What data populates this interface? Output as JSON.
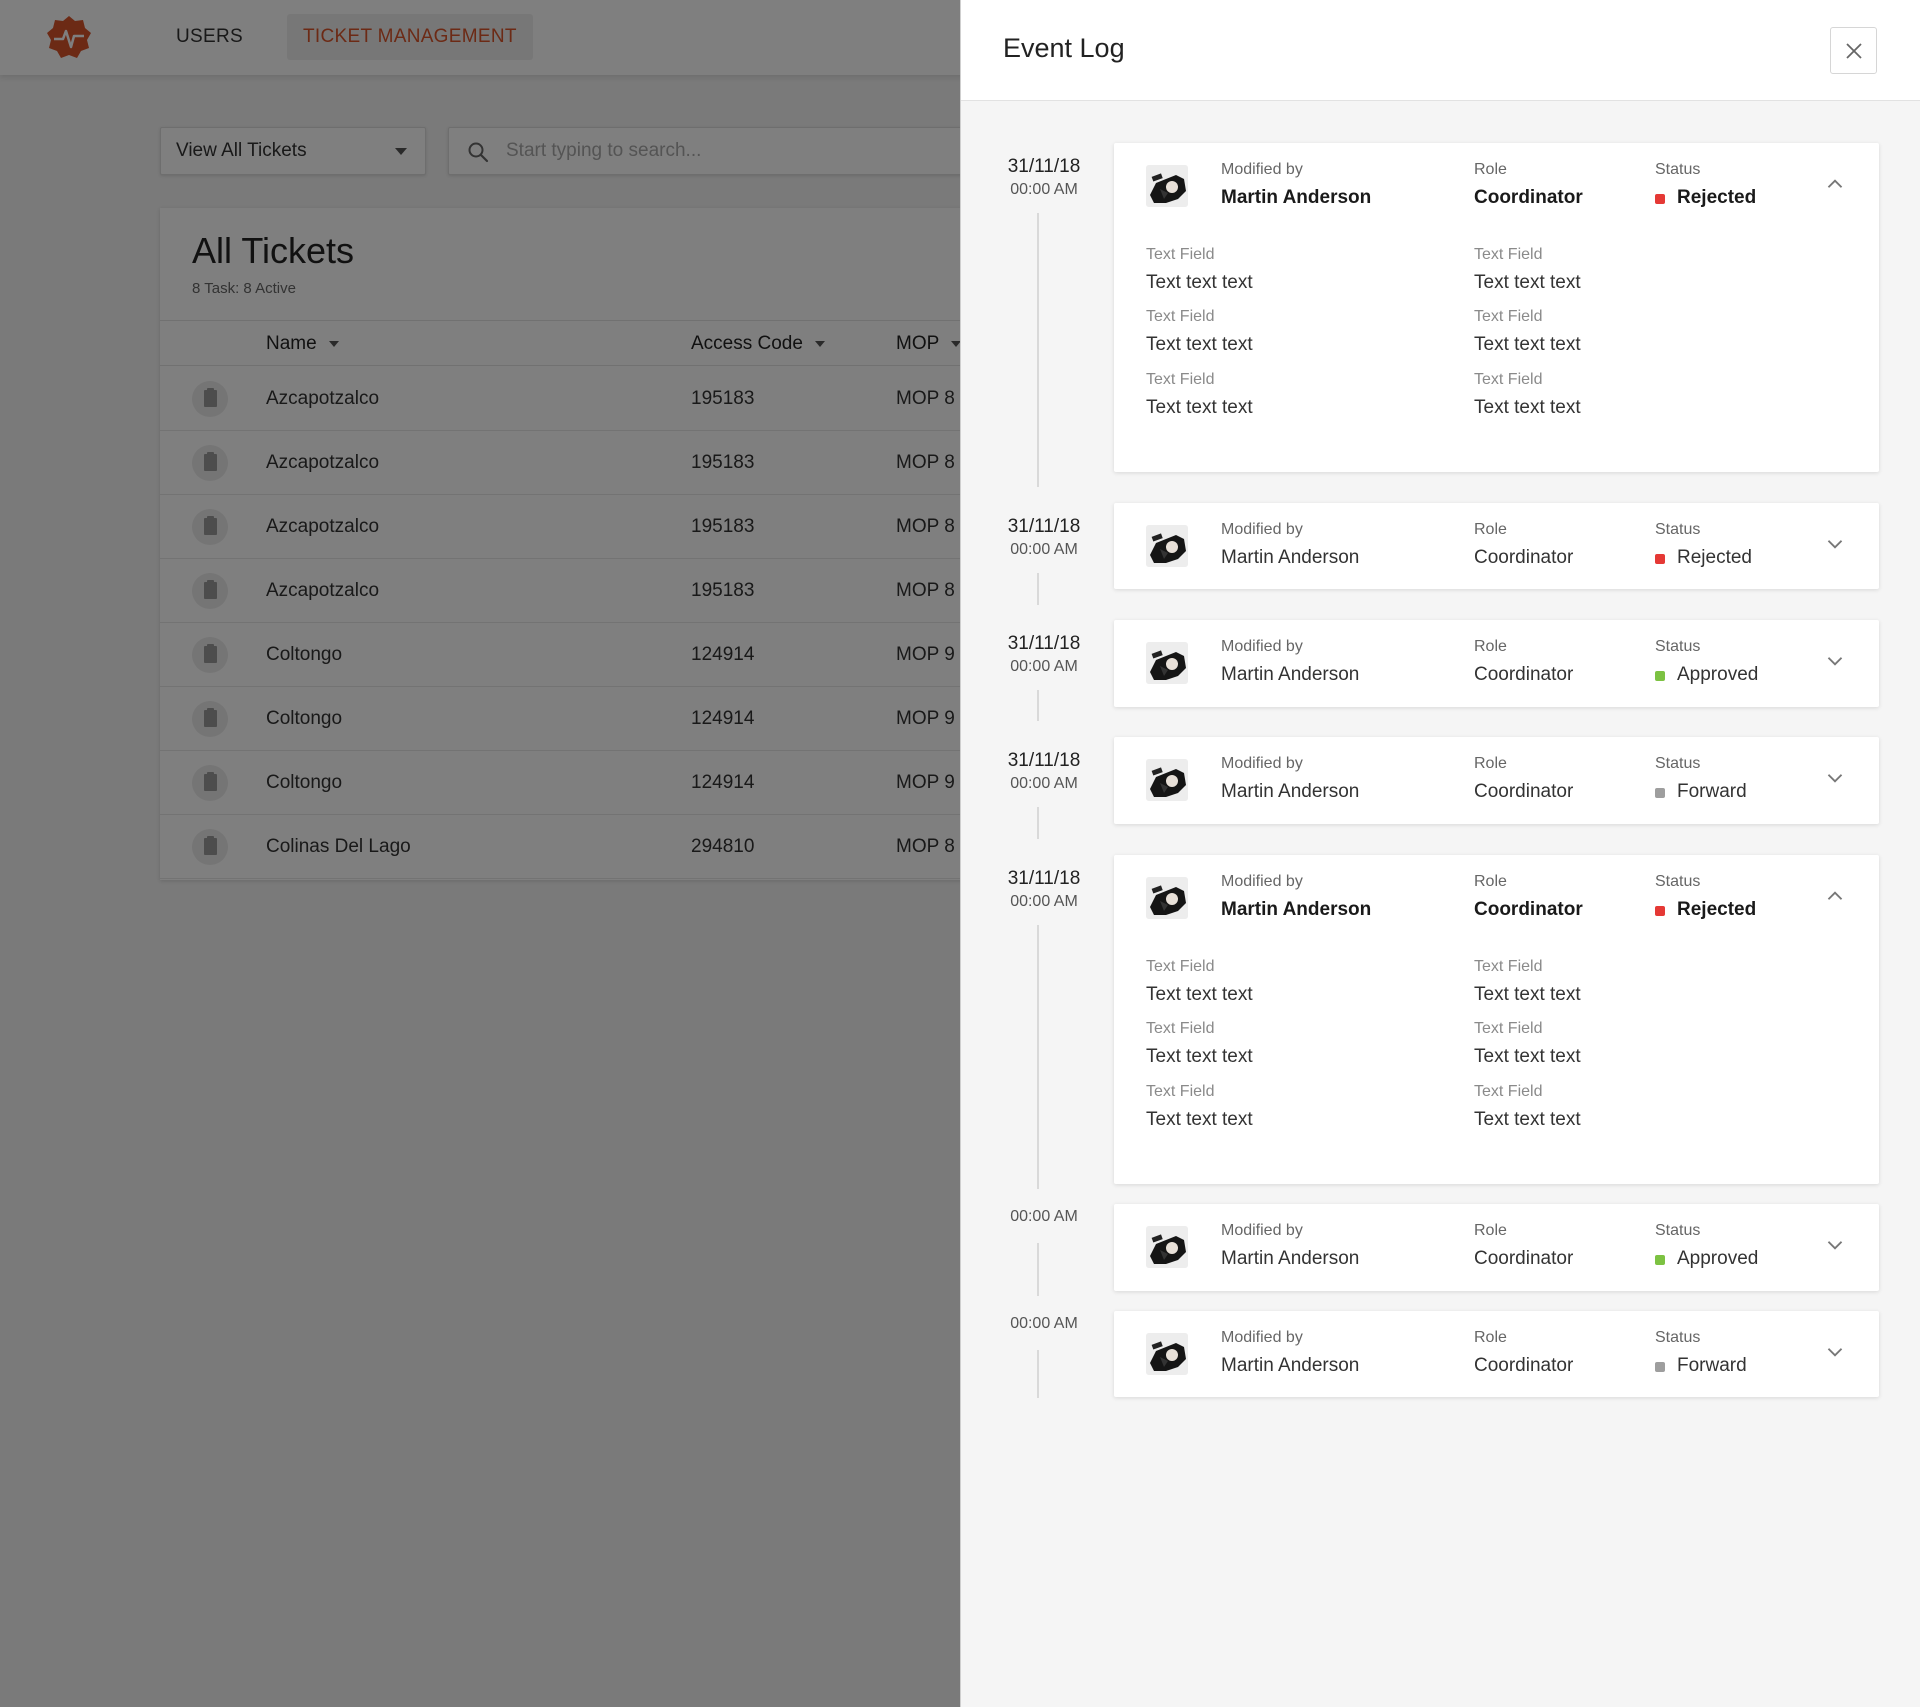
{
  "nav": {
    "items": [
      {
        "label": "USERS"
      },
      {
        "label": "TICKET MANAGEMENT"
      }
    ]
  },
  "toolbar": {
    "view_select": "View All Tickets",
    "search_placeholder": "Start typing to search..."
  },
  "tickets": {
    "title": "All Tickets",
    "subtitle": "8 Task: 8 Active",
    "columns": [
      "Name",
      "Access Code",
      "MOP"
    ],
    "rows": [
      {
        "name": "Azcapotzalco",
        "code": "195183",
        "mop": "MOP 8"
      },
      {
        "name": "Azcapotzalco",
        "code": "195183",
        "mop": "MOP 8"
      },
      {
        "name": "Azcapotzalco",
        "code": "195183",
        "mop": "MOP 8"
      },
      {
        "name": "Azcapotzalco",
        "code": "195183",
        "mop": "MOP 8"
      },
      {
        "name": "Coltongo",
        "code": "124914",
        "mop": "MOP 9"
      },
      {
        "name": "Coltongo",
        "code": "124914",
        "mop": "MOP 9"
      },
      {
        "name": "Coltongo",
        "code": "124914",
        "mop": "MOP 9"
      },
      {
        "name": "Colinas Del Lago",
        "code": "294810",
        "mop": "MOP 8"
      }
    ]
  },
  "event_log": {
    "title": "Event Log",
    "labels": {
      "modified_by": "Modified by",
      "role": "Role",
      "status": "Status"
    },
    "status_colors": {
      "Rejected": "#e53935",
      "Approved": "#7cc242",
      "Forward": "#9e9e9e"
    },
    "events": [
      {
        "date": "31/11/18",
        "time": "00:00 AM",
        "modified_by": "Martin Anderson",
        "role": "Coordinator",
        "status": "Rejected",
        "expanded": true,
        "fields": [
          {
            "label": "Text Field",
            "value": "Text text text"
          },
          {
            "label": "Text Field",
            "value": "Text text text"
          },
          {
            "label": "Text Field",
            "value": "Text text text"
          },
          {
            "label": "Text Field",
            "value": "Text text text"
          },
          {
            "label": "Text Field",
            "value": "Text text text"
          },
          {
            "label": "Text Field",
            "value": "Text text text"
          }
        ]
      },
      {
        "date": "31/11/18",
        "time": "00:00 AM",
        "modified_by": "Martin Anderson",
        "role": "Coordinator",
        "status": "Rejected",
        "expanded": false
      },
      {
        "date": "31/11/18",
        "time": "00:00 AM",
        "modified_by": "Martin Anderson",
        "role": "Coordinator",
        "status": "Approved",
        "expanded": false
      },
      {
        "date": "31/11/18",
        "time": "00:00 AM",
        "modified_by": "Martin Anderson",
        "role": "Coordinator",
        "status": "Forward",
        "expanded": false
      },
      {
        "date": "31/11/18",
        "time": "00:00 AM",
        "modified_by": "Martin Anderson",
        "role": "Coordinator",
        "status": "Rejected",
        "expanded": true,
        "fields": [
          {
            "label": "Text Field",
            "value": "Text text text"
          },
          {
            "label": "Text Field",
            "value": "Text text text"
          },
          {
            "label": "Text Field",
            "value": "Text text text"
          },
          {
            "label": "Text Field",
            "value": "Text text text"
          },
          {
            "label": "Text Field",
            "value": "Text text text"
          },
          {
            "label": "Text Field",
            "value": "Text text text"
          }
        ]
      },
      {
        "date": "",
        "time": "00:00 AM",
        "modified_by": "Martin Anderson",
        "role": "Coordinator",
        "status": "Approved",
        "expanded": false
      },
      {
        "date": "",
        "time": "00:00 AM",
        "modified_by": "Martin Anderson",
        "role": "Coordinator",
        "status": "Forward",
        "expanded": false
      }
    ]
  }
}
